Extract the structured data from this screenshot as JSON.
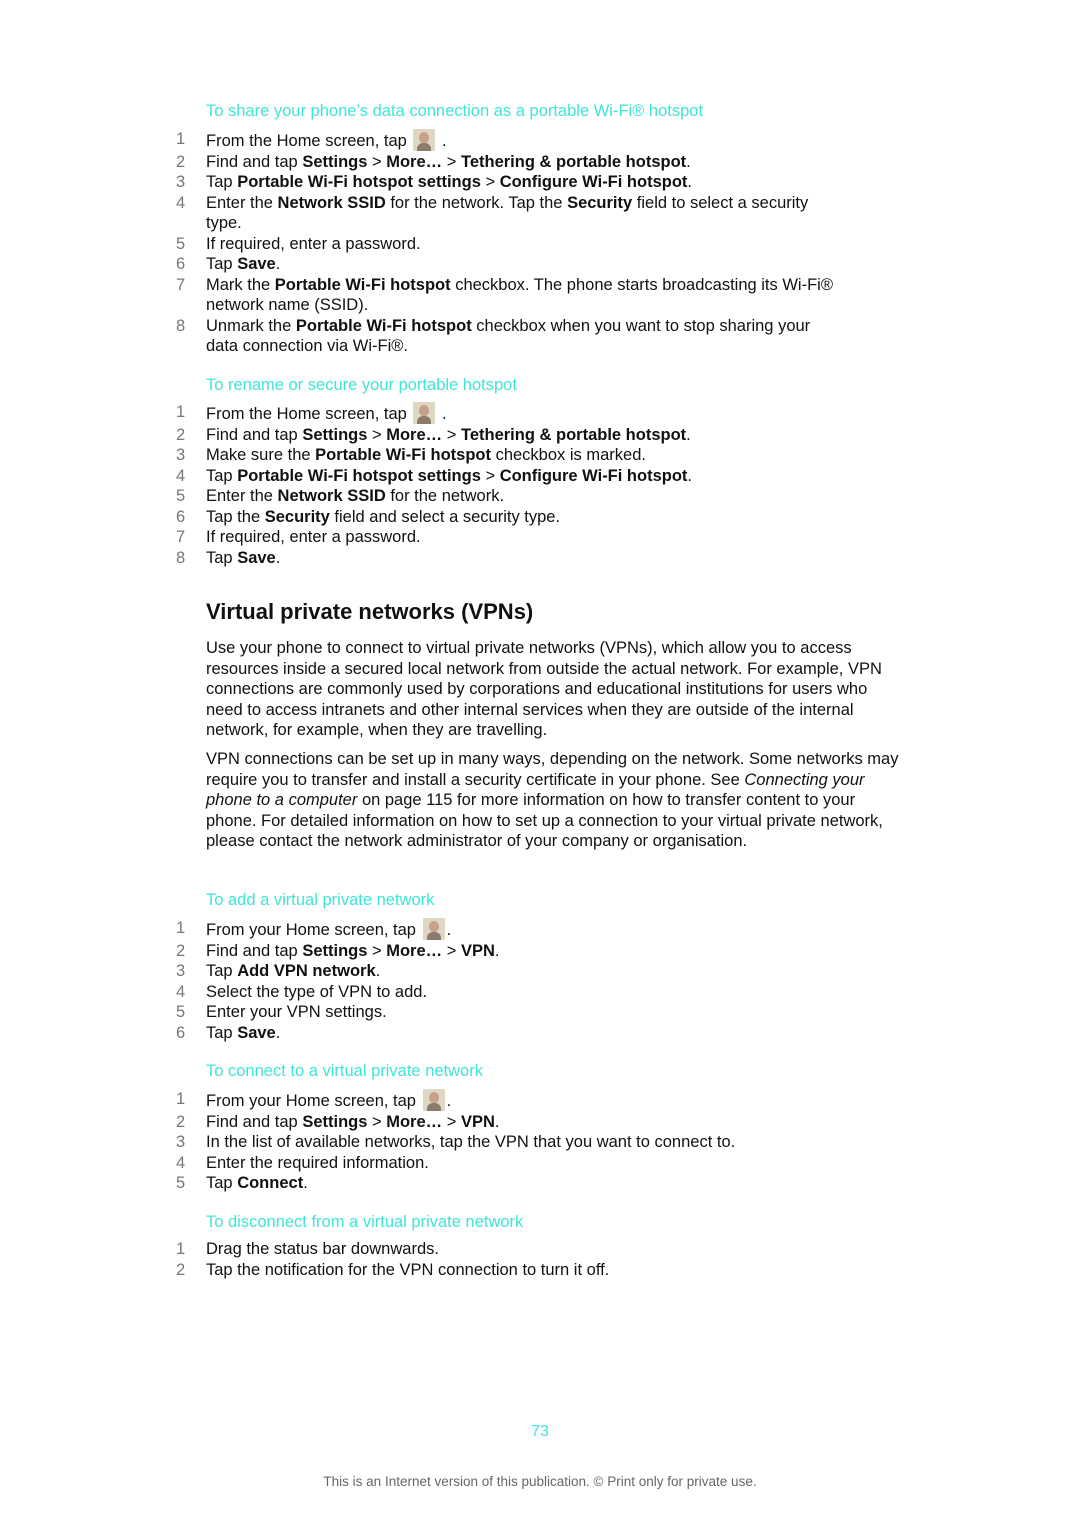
{
  "sections": [
    {
      "heading": "To share your phone’s data connection as a portable Wi-Fi® hotspot",
      "steps": [
        {
          "n": "1",
          "html": "From the Home screen, tap <span class=\"icon-app\" data-name=\"application-screen-icon\" data-interactable=\"false\"></span> ."
        },
        {
          "n": "2",
          "html": "Find and tap <b>Settings</b> &gt; <b>More…</b> &gt; <b>Tethering &amp; portable hotspot</b>."
        },
        {
          "n": "3",
          "html": "Tap <b>Portable Wi-Fi hotspot settings</b> &gt; <b>Configure Wi-Fi hotspot</b>."
        },
        {
          "n": "4",
          "html": "Enter the <b>Network SSID</b> for the network. Tap the <b>Security</b> field to select a security type."
        },
        {
          "n": "5",
          "html": "If required, enter a password."
        },
        {
          "n": "6",
          "html": "Tap <b>Save</b>."
        },
        {
          "n": "7",
          "html": "Mark the <b>Portable Wi-Fi hotspot</b> checkbox. The phone starts broadcasting its Wi-Fi® network name (SSID)."
        },
        {
          "n": "8",
          "html": "Unmark the <b>Portable Wi-Fi hotspot</b> checkbox when you want to stop sharing your data connection via Wi-Fi®."
        }
      ]
    },
    {
      "heading": "To rename or secure your portable hotspot",
      "steps": [
        {
          "n": "1",
          "html": "From the Home screen, tap <span class=\"icon-app\" data-name=\"application-screen-icon\" data-interactable=\"false\"></span> ."
        },
        {
          "n": "2",
          "html": "Find and tap <b>Settings</b> &gt; <b>More…</b> &gt; <b>Tethering &amp; portable hotspot</b>."
        },
        {
          "n": "3",
          "html": "Make sure the <b>Portable Wi-Fi hotspot</b> checkbox is marked."
        },
        {
          "n": "4",
          "html": "Tap <b>Portable Wi-Fi hotspot settings</b> &gt; <b>Configure Wi-Fi hotspot</b>."
        },
        {
          "n": "5",
          "html": "Enter the <b>Network SSID</b> for the network."
        },
        {
          "n": "6",
          "html": "Tap the <b>Security</b> field and select a security type."
        },
        {
          "n": "7",
          "html": "If required, enter a password."
        },
        {
          "n": "8",
          "html": "Tap <b>Save</b>."
        }
      ]
    },
    {
      "heading": "To add a virtual private network",
      "steps": [
        {
          "n": "1",
          "html": "From your Home screen, tap <span class=\"icon-app\" data-name=\"application-screen-icon\" data-interactable=\"false\"></span>."
        },
        {
          "n": "2",
          "html": "Find and tap <b>Settings</b> &gt; <b>More…</b> &gt; <b>VPN</b>."
        },
        {
          "n": "3",
          "html": "Tap <b>Add VPN network</b>."
        },
        {
          "n": "4",
          "html": "Select the type of VPN to add."
        },
        {
          "n": "5",
          "html": "Enter your VPN settings."
        },
        {
          "n": "6",
          "html": "Tap <b>Save</b>."
        }
      ]
    },
    {
      "heading": "To connect to a virtual private network",
      "steps": [
        {
          "n": "1",
          "html": "From your Home screen, tap <span class=\"icon-app\" data-name=\"application-screen-icon\" data-interactable=\"false\"></span>."
        },
        {
          "n": "2",
          "html": "Find and tap <b>Settings</b> &gt; <b>More…</b> &gt; <b>VPN</b>."
        },
        {
          "n": "3",
          "html": "In the list of available networks, tap the VPN that you want to connect to."
        },
        {
          "n": "4",
          "html": "Enter the required information."
        },
        {
          "n": "5",
          "html": "Tap <b>Connect</b>."
        }
      ]
    },
    {
      "heading": "To disconnect from a virtual private network",
      "steps": [
        {
          "n": "1",
          "html": "Drag the status bar downwards."
        },
        {
          "n": "2",
          "html": "Tap the notification for the VPN connection to turn it off."
        }
      ]
    }
  ],
  "vpn": {
    "title": "Virtual private networks (VPNs)",
    "para1": "Use your phone to connect to virtual private networks (VPNs), which allow you to access resources inside a secured local network from outside the actual network. For example, VPN connections are commonly used by corporations and educational institutions for users who need to access intranets and other internal services when they are outside of the internal network, for example, when they are travelling.",
    "para2_html": "VPN connections can be set up in many ways, depending on the network. Some networks may require you to transfer and install a security certificate in your phone. See <i>Connecting your phone to a computer</i> on page 115 for more information on how to transfer content to your phone. For detailed information on how to set up a connection to your virtual private network, please contact the network administrator of your company or organisation."
  },
  "page_number": "73",
  "footer": "This is an Internet version of this publication. © Print only for private use.",
  "colors": {
    "heading": "#3ee6d6",
    "step_number": "#777777",
    "text": "#111111"
  }
}
